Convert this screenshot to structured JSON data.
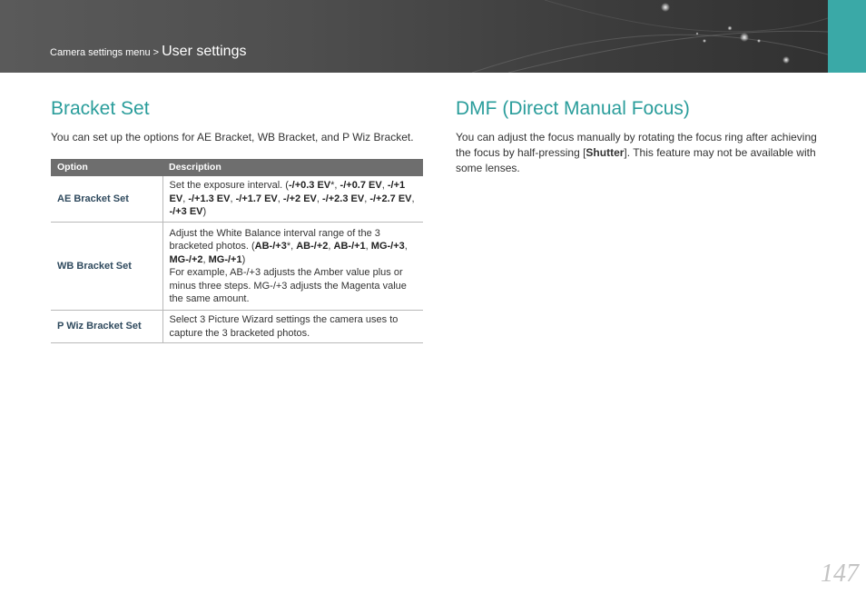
{
  "header": {
    "breadcrumb_parent": "Camera settings menu",
    "breadcrumb_separator": ">",
    "breadcrumb_current": "User settings",
    "accent_color": "#3aa9a7"
  },
  "left": {
    "title": "Bracket Set",
    "intro": "You can set up the options for AE Bracket, WB Bracket, and P Wiz Bracket.",
    "table": {
      "headers": [
        "Option",
        "Description"
      ],
      "rows": [
        {
          "option": "AE Bracket Set",
          "description": [
            {
              "t": "Set the exposure interval. (",
              "b": false
            },
            {
              "t": "-/+0.3 EV",
              "b": true
            },
            {
              "t": "*, ",
              "b": false
            },
            {
              "t": "-/+0.7 EV",
              "b": true
            },
            {
              "t": ", ",
              "b": false
            },
            {
              "t": "-/+1 EV",
              "b": true
            },
            {
              "t": ", ",
              "b": false
            },
            {
              "t": "-/+1.3 EV",
              "b": true
            },
            {
              "t": ", ",
              "b": false
            },
            {
              "t": "-/+1.7 EV",
              "b": true
            },
            {
              "t": ", ",
              "b": false
            },
            {
              "t": "-/+2 EV",
              "b": true
            },
            {
              "t": ", ",
              "b": false
            },
            {
              "t": "-/+2.3 EV",
              "b": true
            },
            {
              "t": ", ",
              "b": false
            },
            {
              "t": "-/+2.7 EV",
              "b": true
            },
            {
              "t": ", ",
              "b": false
            },
            {
              "t": "-/+3 EV",
              "b": true
            },
            {
              "t": ")",
              "b": false
            }
          ]
        },
        {
          "option": "WB Bracket Set",
          "description": [
            {
              "t": "Adjust the White Balance interval range of the 3 bracketed photos. (",
              "b": false
            },
            {
              "t": "AB-/+3",
              "b": true
            },
            {
              "t": "*, ",
              "b": false
            },
            {
              "t": "AB-/+2",
              "b": true
            },
            {
              "t": ", ",
              "b": false
            },
            {
              "t": "AB-/+1",
              "b": true
            },
            {
              "t": ", ",
              "b": false
            },
            {
              "t": "MG-/+3",
              "b": true
            },
            {
              "t": ", ",
              "b": false
            },
            {
              "t": "MG-/+2",
              "b": true
            },
            {
              "t": ", ",
              "b": false
            },
            {
              "t": "MG-/+1",
              "b": true
            },
            {
              "t": ")",
              "b": false
            }
          ],
          "note": "For example, AB-/+3 adjusts the Amber value plus or minus three steps. MG-/+3 adjusts the Magenta value the same amount."
        },
        {
          "option": "P Wiz Bracket Set",
          "description": [
            {
              "t": "Select 3 Picture Wizard settings the camera uses to capture the 3 bracketed photos.",
              "b": false
            }
          ]
        }
      ]
    }
  },
  "right": {
    "title": "DMF (Direct Manual Focus)",
    "body": [
      {
        "t": "You can adjust the focus manually by rotating the focus ring after achieving the focus by half-pressing [",
        "b": false
      },
      {
        "t": "Shutter",
        "b": true
      },
      {
        "t": "]. This feature may not be available with some lenses.",
        "b": false
      }
    ]
  },
  "page_number": "147"
}
